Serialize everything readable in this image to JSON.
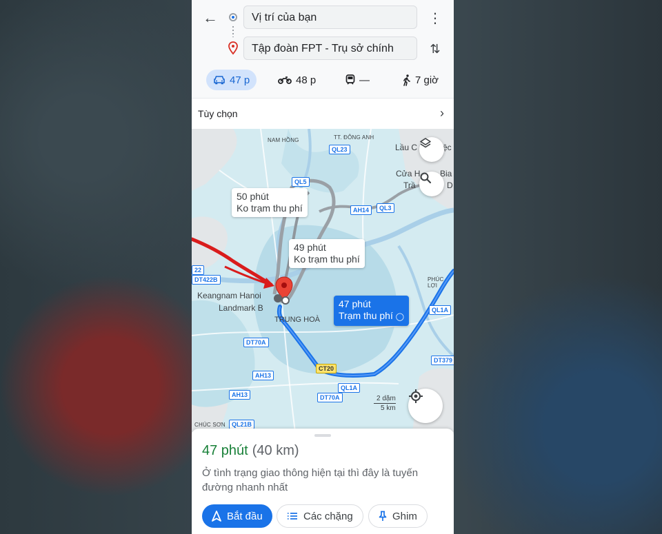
{
  "directions": {
    "origin_value": "Vị trí của bạn",
    "destination_value": "Tập đoàn FPT - Trụ sở chính"
  },
  "icons": {
    "back": "arrow-left-icon",
    "more": "more-vert-icon",
    "swap": "swap-vert-icon",
    "car": "car-icon",
    "motorbike": "motorbike-icon",
    "transit": "train-icon",
    "walk": "walk-icon",
    "layers": "layers-icon",
    "search": "search-icon",
    "locate": "my-location-icon",
    "start": "navigation-icon",
    "steps": "list-icon",
    "pin": "pin-icon"
  },
  "modes": [
    {
      "id": "car",
      "label": "47 p",
      "active": true
    },
    {
      "id": "motorbike",
      "label": "48 p",
      "active": false
    },
    {
      "id": "transit",
      "label": "—",
      "active": false
    },
    {
      "id": "walk",
      "label": "7 giờ",
      "active": false
    }
  ],
  "options": {
    "label": "Tùy chọn"
  },
  "map": {
    "routes": [
      {
        "time": "50 phút",
        "note": "Ko trạm thu phí",
        "selected": false
      },
      {
        "time": "49 phút",
        "note": "Ko trạm thu phí",
        "selected": false
      },
      {
        "time": "47 phút",
        "note": "Trạm thu phí",
        "selected": true
      }
    ],
    "places": {
      "dong_anh": "TT. ĐÔNG ANH",
      "nam_hong": "NAM HỒNG",
      "lau_co": "Lầu C",
      "lau_co_tail": "ệc",
      "cua_hang": "Cửa H",
      "cua_hang_tail": "Bia",
      "tran": "Trầ",
      "tran_tail": "D",
      "keangnam_1": "Keangnam Hanoi",
      "keangnam_2": "Landmark B",
      "trung_hoa": "TRUNG HOÀ",
      "phuc_loi": "PHÚC LỢI",
      "chuc_son": "CHÚC SƠN"
    },
    "shields": {
      "ql23": "QL23",
      "ql5": "QL5",
      "ah14": "AH14",
      "ql3": "QL3",
      "dt422b": "DT422B",
      "num22": "22",
      "ql1a_right": "QL1A",
      "dt70a_left": "DT70A",
      "ah13_a": "AH13",
      "ah13_b": "AH13",
      "ct20": "CT20",
      "ql1a_bottom": "QL1A",
      "dt70a_bottom": "DT70A",
      "dt379": "DT379",
      "ql21b": "QL21B"
    },
    "scale": {
      "top": "2 dặm",
      "bottom": "5 km"
    }
  },
  "sheet": {
    "duration": "47 phút",
    "distance": "(40 km)",
    "description": "Ở tình trạng giao thông hiện tại thì đây là tuyến đường nhanh nhất",
    "start_label": "Bắt đầu",
    "steps_label": "Các chặng",
    "pin_label": "Ghim"
  },
  "colors": {
    "accent": "#1a73e8",
    "duration_green": "#188038",
    "annotation_red": "#d91c1c"
  }
}
